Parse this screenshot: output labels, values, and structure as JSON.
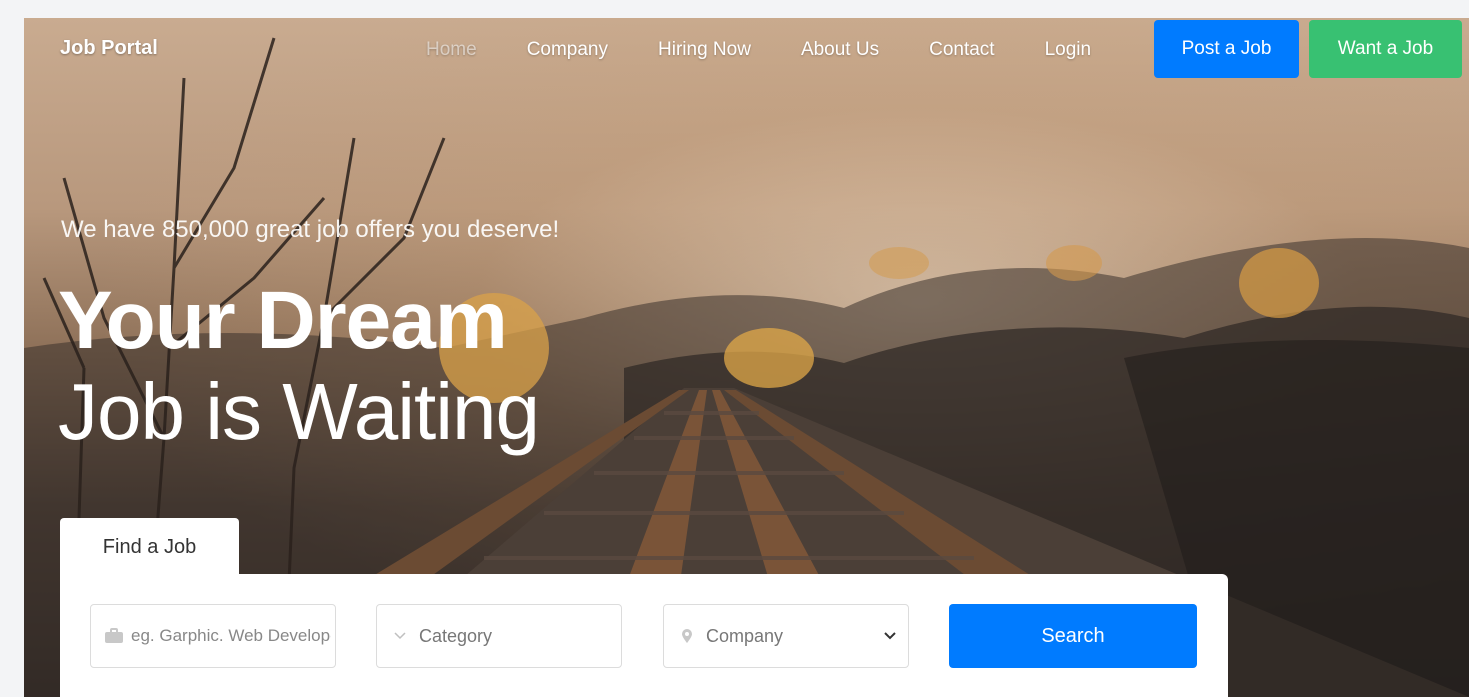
{
  "nav": {
    "brand": "Job Portal",
    "links": [
      {
        "label": "Home",
        "active": true
      },
      {
        "label": "Company"
      },
      {
        "label": "Hiring Now"
      },
      {
        "label": "About Us"
      },
      {
        "label": "Contact"
      },
      {
        "label": "Login"
      }
    ],
    "post_job": "Post a Job",
    "want_job": "Want a Job"
  },
  "hero": {
    "tagline": "We have 850,000 great job offers you deserve!",
    "headline_bold": "Your Dream",
    "headline_light": "Job is Waiting"
  },
  "search": {
    "tab_label": "Find a Job",
    "keyword_placeholder": "eg. Garphic. Web Developer",
    "category_label": "Category",
    "company_label": "Company",
    "button_label": "Search"
  },
  "colors": {
    "primary": "#007bff",
    "success": "#38c172"
  }
}
